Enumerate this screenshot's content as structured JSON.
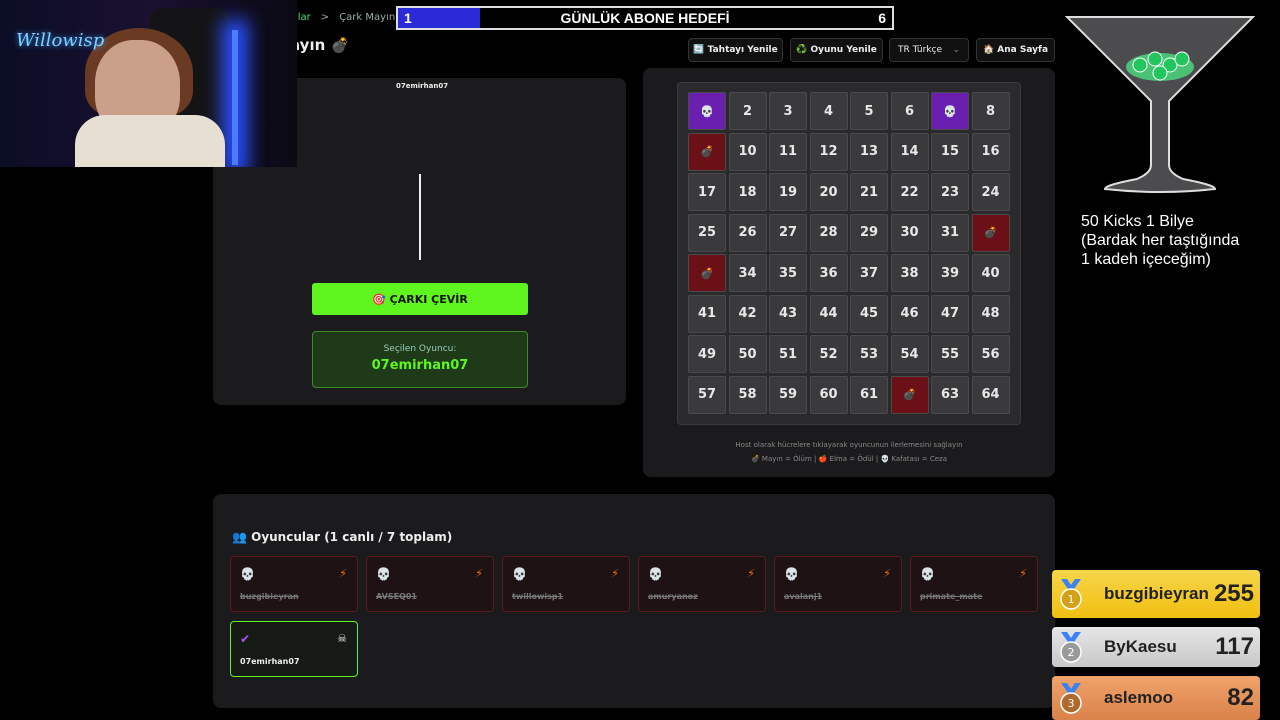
{
  "breadcrumb": {
    "prev": "ılar",
    "sep": ">",
    "current": "Çark Mayın"
  },
  "page_title": "ayın 💣",
  "goal": {
    "label": "GÜNLÜK ABONE HEDEFİ",
    "current": "1",
    "target": "6",
    "progress": 0.1667
  },
  "toolbar": {
    "refresh_board": "🔄 Tahtayı Yenile",
    "restart_game": "♻️ Oyunu Yenile",
    "language": "TR Türkçe",
    "home": "🏠 Ana Sayfa"
  },
  "wheel": {
    "current_name": "07emirhan07",
    "spin_label": "🎯 ÇARKI ÇEVİR",
    "selected_label": "Seçilen Oyuncu:",
    "selected_value": "07emirhan07"
  },
  "board": {
    "cells": [
      {
        "t": "💀",
        "k": "skull"
      },
      {
        "t": "2"
      },
      {
        "t": "3"
      },
      {
        "t": "4"
      },
      {
        "t": "5"
      },
      {
        "t": "6"
      },
      {
        "t": "💀",
        "k": "skull"
      },
      {
        "t": "8"
      },
      {
        "t": "💣",
        "k": "mine"
      },
      {
        "t": "10"
      },
      {
        "t": "11"
      },
      {
        "t": "12"
      },
      {
        "t": "13"
      },
      {
        "t": "14"
      },
      {
        "t": "15"
      },
      {
        "t": "16"
      },
      {
        "t": "17"
      },
      {
        "t": "18"
      },
      {
        "t": "19"
      },
      {
        "t": "20"
      },
      {
        "t": "21"
      },
      {
        "t": "22"
      },
      {
        "t": "23"
      },
      {
        "t": "24"
      },
      {
        "t": "25"
      },
      {
        "t": "26"
      },
      {
        "t": "27"
      },
      {
        "t": "28"
      },
      {
        "t": "29"
      },
      {
        "t": "30"
      },
      {
        "t": "31"
      },
      {
        "t": "💣",
        "k": "mine"
      },
      {
        "t": "💣",
        "k": "mine"
      },
      {
        "t": "34"
      },
      {
        "t": "35"
      },
      {
        "t": "36"
      },
      {
        "t": "37"
      },
      {
        "t": "38"
      },
      {
        "t": "39"
      },
      {
        "t": "40"
      },
      {
        "t": "41"
      },
      {
        "t": "42"
      },
      {
        "t": "43"
      },
      {
        "t": "44"
      },
      {
        "t": "45"
      },
      {
        "t": "46"
      },
      {
        "t": "47"
      },
      {
        "t": "48"
      },
      {
        "t": "49"
      },
      {
        "t": "50"
      },
      {
        "t": "51"
      },
      {
        "t": "52"
      },
      {
        "t": "53"
      },
      {
        "t": "54"
      },
      {
        "t": "55"
      },
      {
        "t": "56"
      },
      {
        "t": "57"
      },
      {
        "t": "58"
      },
      {
        "t": "59"
      },
      {
        "t": "60"
      },
      {
        "t": "61"
      },
      {
        "t": "💣",
        "k": "mine"
      },
      {
        "t": "63"
      },
      {
        "t": "64"
      }
    ],
    "hint": "Host olarak hücrelere tıklayarak oyuncunun ilerlemesini sağlayın",
    "legend": "💣 Mayın = Ölüm | 🍎 Elma = Ödül | 💀 Kafatası = Ceza"
  },
  "players": {
    "title": "👥 Oyuncular (1 canlı / 7 toplam)",
    "list": [
      {
        "name": "buzgibieyran",
        "icon": "💀",
        "status": "⚡",
        "alive": false
      },
      {
        "name": "AVSEQ01",
        "icon": "💀",
        "status": "⚡",
        "alive": false
      },
      {
        "name": "twillowisp1",
        "icon": "💀",
        "status": "⚡",
        "alive": false
      },
      {
        "name": "amuryanoz",
        "icon": "💀",
        "status": "⚡",
        "alive": false
      },
      {
        "name": "avalanj1",
        "icon": "💀",
        "status": "⚡",
        "alive": false
      },
      {
        "name": "primate_mate",
        "icon": "💀",
        "status": "⚡",
        "alive": false
      },
      {
        "name": "07emirhan07",
        "icon": "✔",
        "status": "☠",
        "alive": true
      }
    ]
  },
  "overlay": {
    "cam_logo": "Willowisp",
    "kicks_line1": "50 Kicks 1 Bilye",
    "kicks_line2": "(Bardak her taştığında",
    "kicks_line3": "1 kadeh içeceğim)"
  },
  "leaderboard": [
    {
      "rank": "1",
      "name": "buzgibieyran",
      "score": "255"
    },
    {
      "rank": "2",
      "name": "ByKaesu",
      "score": "117"
    },
    {
      "rank": "3",
      "name": "aslemoo",
      "score": "82"
    }
  ],
  "colors": {
    "accent_green": "#5ef61e",
    "mine": "#6b1016",
    "skull": "#6a1fb0",
    "goal_fill": "#2a2ad8"
  }
}
